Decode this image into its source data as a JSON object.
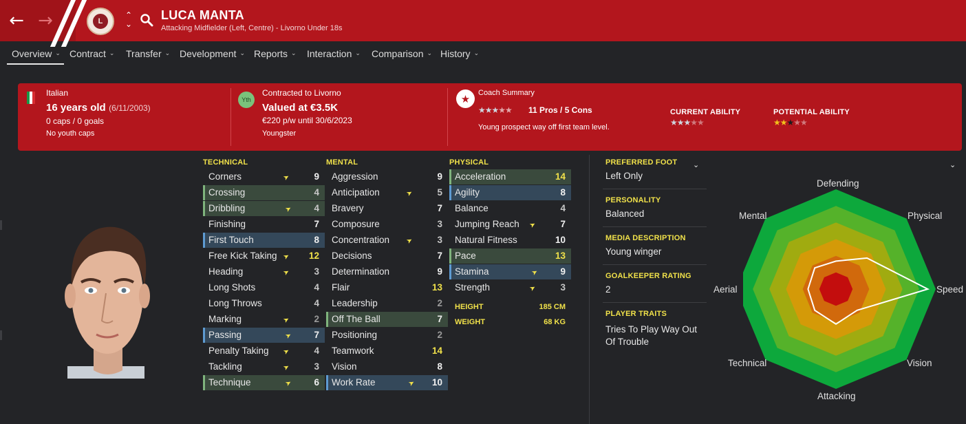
{
  "header": {
    "player_name": "LUCA MANTA",
    "subtitle": "Attacking Midfielder (Left, Centre) - Livorno Under 18s",
    "back_icon": "arrow-left-icon",
    "forward_icon": "arrow-right-icon",
    "club_badge": "livorno-crest",
    "search_icon": "search-icon",
    "accent_color": "#b3161d"
  },
  "tabs": [
    {
      "label": "Overview"
    },
    {
      "label": "Contract"
    },
    {
      "label": "Transfer"
    },
    {
      "label": "Development"
    },
    {
      "label": "Reports"
    },
    {
      "label": "Interaction"
    },
    {
      "label": "Comparison"
    },
    {
      "label": "History"
    }
  ],
  "banner": {
    "nationality": "Italian",
    "age": "16 years old",
    "dob": "(6/11/2003)",
    "caps_goals": "0 caps / 0 goals",
    "youth_caps": "No youth caps",
    "contract_badge": "Yth",
    "contracted_to": "Contracted to Livorno",
    "value": "Valued at €3.5K",
    "wage": "€220 p/w until 30/6/2023",
    "contract_type": "Youngster",
    "coach_title": "Coach Summary",
    "coach_stars": 3,
    "pros_cons": "11 Pros / 5 Cons",
    "coach_text": "Young prospect way off first team level.",
    "current_ability_label": "CURRENT ABILITY",
    "current_ability_stars": 3,
    "potential_ability_label": "POTENTIAL ABILITY",
    "potential_ability_stars": 2.5
  },
  "technical": {
    "title": "TECHNICAL",
    "rows": [
      {
        "name": "Corners",
        "value": "9",
        "flair": true
      },
      {
        "name": "Crossing",
        "value": "4",
        "hl": "g"
      },
      {
        "name": "Dribbling",
        "value": "4",
        "hl": "g",
        "flair": true
      },
      {
        "name": "Finishing",
        "value": "7"
      },
      {
        "name": "First Touch",
        "value": "8",
        "hl": "b"
      },
      {
        "name": "Free Kick Taking",
        "value": "12",
        "flair": true
      },
      {
        "name": "Heading",
        "value": "3",
        "flair": true
      },
      {
        "name": "Long Shots",
        "value": "4"
      },
      {
        "name": "Long Throws",
        "value": "4"
      },
      {
        "name": "Marking",
        "value": "2",
        "flair": true
      },
      {
        "name": "Passing",
        "value": "7",
        "hl": "b",
        "flair": true
      },
      {
        "name": "Penalty Taking",
        "value": "4",
        "flair": true
      },
      {
        "name": "Tackling",
        "value": "3",
        "flair": true
      },
      {
        "name": "Technique",
        "value": "6",
        "hl": "g",
        "flair": true
      }
    ]
  },
  "mental": {
    "title": "MENTAL",
    "rows": [
      {
        "name": "Aggression",
        "value": "9"
      },
      {
        "name": "Anticipation",
        "value": "5",
        "flair": true
      },
      {
        "name": "Bravery",
        "value": "7"
      },
      {
        "name": "Composure",
        "value": "3"
      },
      {
        "name": "Concentration",
        "value": "3",
        "flair": true
      },
      {
        "name": "Decisions",
        "value": "7"
      },
      {
        "name": "Determination",
        "value": "9"
      },
      {
        "name": "Flair",
        "value": "13"
      },
      {
        "name": "Leadership",
        "value": "2"
      },
      {
        "name": "Off The Ball",
        "value": "7",
        "hl": "g"
      },
      {
        "name": "Positioning",
        "value": "2"
      },
      {
        "name": "Teamwork",
        "value": "14"
      },
      {
        "name": "Vision",
        "value": "8"
      },
      {
        "name": "Work Rate",
        "value": "10",
        "hl": "b",
        "flair": true
      }
    ]
  },
  "physical": {
    "title": "PHYSICAL",
    "rows": [
      {
        "name": "Acceleration",
        "value": "14",
        "hl": "g"
      },
      {
        "name": "Agility",
        "value": "8",
        "hl": "b"
      },
      {
        "name": "Balance",
        "value": "4"
      },
      {
        "name": "Jumping Reach",
        "value": "7",
        "flair": true
      },
      {
        "name": "Natural Fitness",
        "value": "10"
      },
      {
        "name": "Pace",
        "value": "13",
        "hl": "g"
      },
      {
        "name": "Stamina",
        "value": "9",
        "hl": "b",
        "flair": true
      },
      {
        "name": "Strength",
        "value": "3",
        "flair": true
      }
    ],
    "height_label": "HEIGHT",
    "height_value": "185 CM",
    "weight_label": "WEIGHT",
    "weight_value": "68 KG"
  },
  "profile": {
    "preferred_foot_label": "PREFERRED FOOT",
    "preferred_foot": "Left Only",
    "personality_label": "PERSONALITY",
    "personality": "Balanced",
    "media_label": "MEDIA DESCRIPTION",
    "media": "Young winger",
    "gk_label": "GOALKEEPER RATING",
    "gk": "2",
    "traits_label": "PLAYER TRAITS",
    "traits": "Tries To Play Way Out Of Trouble"
  },
  "radar": {
    "axes": [
      "Defending",
      "Physical",
      "Speed",
      "Vision",
      "Attacking",
      "Technical",
      "Aerial",
      "Mental"
    ],
    "player_values": [
      0.28,
      0.44,
      0.92,
      0.3,
      0.35,
      0.3,
      0.28,
      0.3
    ],
    "ring_colors": [
      "#0da83c",
      "#55b22a",
      "#a0ab10",
      "#d49a08",
      "#d1690c",
      "#c30d0d"
    ]
  }
}
